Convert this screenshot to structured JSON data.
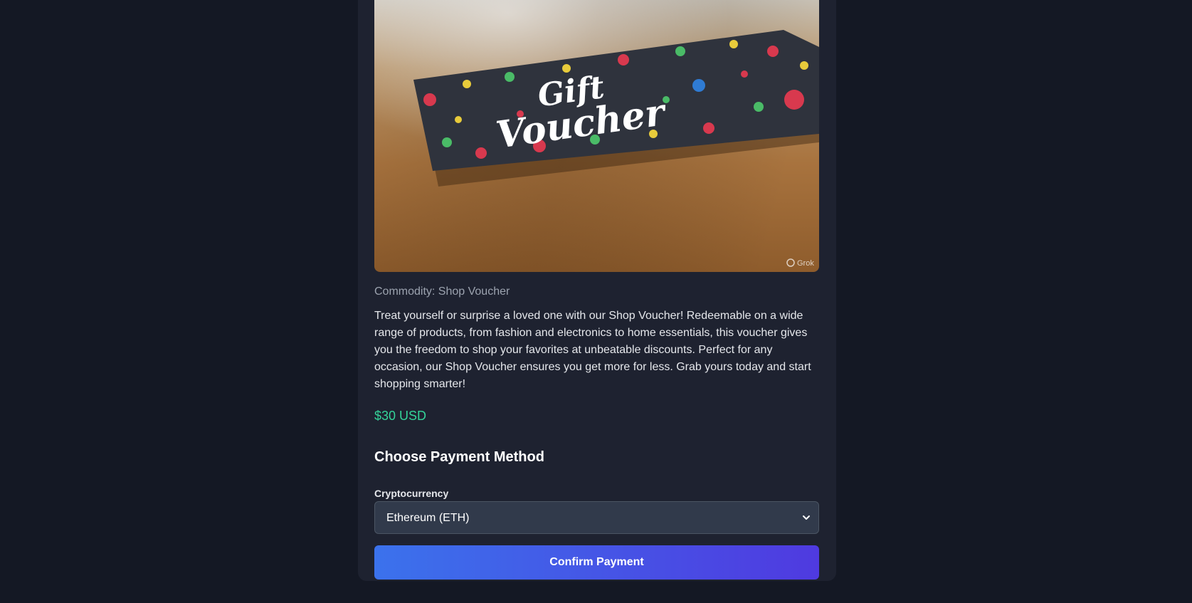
{
  "product": {
    "image_alt": "Gift Voucher",
    "image_card_text_line1": "Gift",
    "image_card_text_line2": "Voucher",
    "image_watermark": "Grok",
    "commodity_label": "Commodity: Shop Voucher",
    "description": "Treat yourself or surprise a loved one with our Shop Voucher! Redeemable on a wide range of products, from fashion and electronics to home essentials, this voucher gives you the freedom to shop your favorites at unbeatable discounts. Perfect for any occasion, our Shop Voucher ensures you get more for less. Grab yours today and start shopping smarter!",
    "price": "$30 USD"
  },
  "payment": {
    "heading": "Choose Payment Method",
    "field_label": "Cryptocurrency",
    "selected_option": "Ethereum (ETH)",
    "confirm_label": "Confirm Payment"
  },
  "colors": {
    "page_background": "#141824",
    "card_background": "#1e2230",
    "price_color": "#34d399",
    "button_gradient_start": "#3b72ec",
    "button_gradient_end": "#4f3ae0"
  },
  "icons": {
    "select_chevron": "chevron-down-icon",
    "watermark": "grok-logo-icon"
  }
}
